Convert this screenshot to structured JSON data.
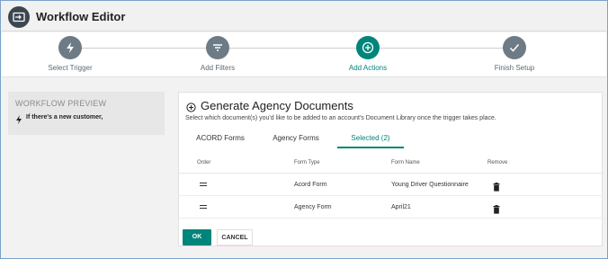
{
  "header": {
    "title": "Workflow Editor"
  },
  "stepper": {
    "steps": [
      {
        "label": "Select Trigger",
        "icon": "bolt-icon",
        "active": false
      },
      {
        "label": "Add Filters",
        "icon": "filter-icon",
        "active": false
      },
      {
        "label": "Add Actions",
        "icon": "plus-circle-icon",
        "active": true
      },
      {
        "label": "Finish Setup",
        "icon": "check-icon",
        "active": false
      }
    ]
  },
  "preview": {
    "title": "WORKFLOW PREVIEW",
    "trigger_text": "If there's a new customer,"
  },
  "card": {
    "title": "Generate Agency Documents",
    "description": "Select which document(s) you'd like to be added to an account's Document Library once the trigger takes place.",
    "tabs": [
      "ACORD Forms",
      "Agency Forms",
      "Selected (2)"
    ],
    "selected_tab_index": 2,
    "table": {
      "headers": [
        "Order",
        "Form Type",
        "Form Name",
        "Remove"
      ],
      "rows": [
        {
          "form_type": "Acord Form",
          "form_name": "Young Driver Questionnaire"
        },
        {
          "form_type": "Agency Form",
          "form_name": "April21"
        }
      ]
    },
    "buttons": {
      "ok": "OK",
      "cancel": "CANCEL"
    }
  },
  "colors": {
    "accent": "#00857a",
    "inactive_step": "#6d7b86",
    "header_icon_bg": "#3c4650"
  }
}
